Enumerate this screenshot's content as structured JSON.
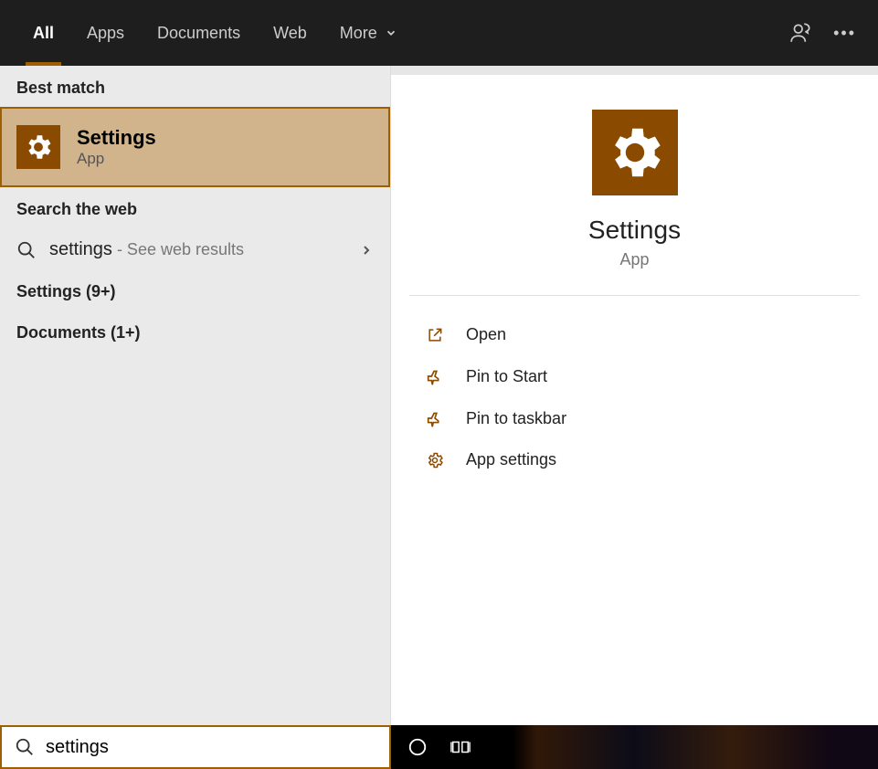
{
  "header": {
    "tabs": [
      "All",
      "Apps",
      "Documents",
      "Web",
      "More"
    ]
  },
  "left": {
    "bestMatchLabel": "Best match",
    "bestMatch": {
      "title": "Settings",
      "sub": "App"
    },
    "searchWebLabel": "Search the web",
    "webRow": {
      "query": "settings",
      "hint": " - See web results"
    },
    "categories": [
      {
        "label": "Settings (9+)"
      },
      {
        "label": "Documents (1+)"
      }
    ]
  },
  "right": {
    "hero": {
      "title": "Settings",
      "sub": "App"
    },
    "actions": [
      {
        "icon": "open",
        "label": "Open"
      },
      {
        "icon": "pin",
        "label": "Pin to Start"
      },
      {
        "icon": "pin",
        "label": "Pin to taskbar"
      },
      {
        "icon": "gear",
        "label": "App settings"
      }
    ]
  },
  "search": {
    "value": "settings"
  },
  "colors": {
    "accent": "#8a4a00"
  }
}
